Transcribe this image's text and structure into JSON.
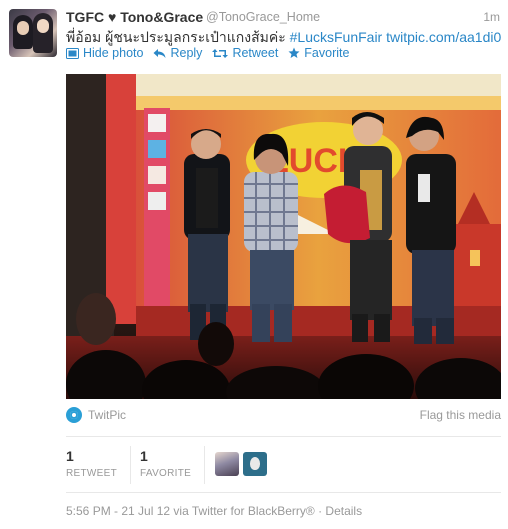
{
  "tweet": {
    "display_name": "TGFC ♥ Tono&Grace",
    "handle": "@TonoGrace_Home",
    "relative_time": "1m",
    "text_prefix": "พี่อ้อม ผู้ชนะประมูลกระเป๋าแกงส้มค่ะ ",
    "hashtag": "#LucksFunFair",
    "link": "twitpic.com/aa1di0"
  },
  "actions": {
    "hide_photo": "Hide photo",
    "reply": "Reply",
    "retweet": "Retweet",
    "favorite": "Favorite"
  },
  "media": {
    "provider": "TwitPic",
    "flag": "Flag this media"
  },
  "stats": {
    "retweets_count": "1",
    "retweets_label": "RETWEET",
    "favorites_count": "1",
    "favorites_label": "FAVORITE"
  },
  "footer": {
    "timestamp": "5:56 PM - 21 Jul 12",
    "via": "via Twitter for BlackBerry®",
    "separator": "·",
    "details": "Details"
  },
  "colors": {
    "link": "#2a87c7",
    "muted": "#999999",
    "text": "#333333"
  }
}
